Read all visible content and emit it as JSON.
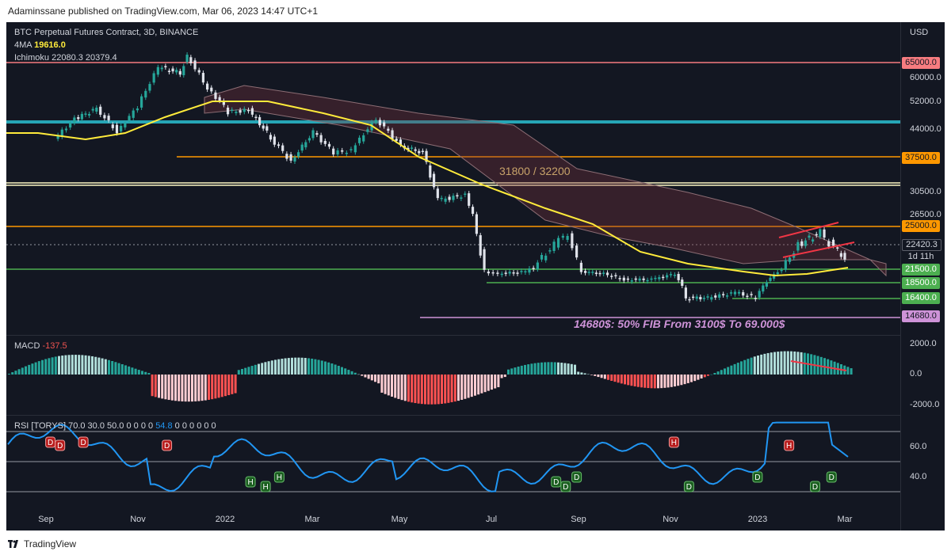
{
  "header": {
    "published": "Adaminssane published on TradingView.com, Mar 06, 2023 14:47 UTC+1"
  },
  "footer": {
    "brand": "TradingView",
    "logo_icon": "tradingview-logo-icon"
  },
  "legend": {
    "symbol": "BTC Perpetual Futures Contract, 3D, BINANCE",
    "ma_label": "4MA",
    "ma_value": "19616.0",
    "ichimoku_label": "Ichimoku",
    "ichimoku_values": "22080.3  20379.4",
    "macd_label": "MACD",
    "macd_value": "-137.5",
    "rsi_label": "RSI [TORYS]",
    "rsi_params": "70.0  30.0  50.0  0  0  0  0",
    "rsi_value": "54.8",
    "rsi_zeros": "0  0  0  0  0  0"
  },
  "chart_data": {
    "type": "candlestick",
    "currency": "USD",
    "x_ticks": [
      "Sep",
      "Nov",
      "2022",
      "Mar",
      "May",
      "Jul",
      "Sep",
      "Nov",
      "2023",
      "Mar"
    ],
    "price_axis_ticks": [
      "60000.0",
      "52000.0",
      "44000.0",
      "30500.0",
      "26500.0"
    ],
    "price_levels": [
      {
        "label": "65000.0",
        "value": 65000,
        "color": "#f77c80"
      },
      {
        "label": "37500.0",
        "value": 37500,
        "color": "#ff9800"
      },
      {
        "label": "25000.0",
        "value": 25000,
        "color": "#ff9800"
      },
      {
        "label": "21500.0",
        "value": 21500,
        "color": "#4caf50"
      },
      {
        "label": "18500.0",
        "value": 18500,
        "color": "#4caf50"
      },
      {
        "label": "16400.0",
        "value": 16400,
        "color": "#4caf50"
      },
      {
        "label": "14680.0",
        "value": 14680,
        "color": "#ce93d8"
      }
    ],
    "current_price": {
      "label": "22420.3",
      "countdown": "1d 11h"
    },
    "annotations": [
      "31800 / 32200",
      "14680$: 50% FIB From 3100$ To 69.000$"
    ],
    "price_series": [
      {
        "d": "2021-08-05",
        "c": 41500
      },
      {
        "d": "2021-08-20",
        "c": 47000
      },
      {
        "d": "2021-09-05",
        "c": 50000
      },
      {
        "d": "2021-09-20",
        "c": 43500
      },
      {
        "d": "2021-10-05",
        "c": 50500
      },
      {
        "d": "2021-10-20",
        "c": 63500
      },
      {
        "d": "2021-11-05",
        "c": 61500
      },
      {
        "d": "2021-11-10",
        "c": 67500
      },
      {
        "d": "2021-11-25",
        "c": 56500
      },
      {
        "d": "2021-12-10",
        "c": 49000
      },
      {
        "d": "2021-12-25",
        "c": 49500
      },
      {
        "d": "2022-01-10",
        "c": 42000
      },
      {
        "d": "2022-01-25",
        "c": 36500
      },
      {
        "d": "2022-02-10",
        "c": 43500
      },
      {
        "d": "2022-02-25",
        "c": 38500
      },
      {
        "d": "2022-03-10",
        "c": 39000
      },
      {
        "d": "2022-03-28",
        "c": 47000
      },
      {
        "d": "2022-04-15",
        "c": 40000
      },
      {
        "d": "2022-05-01",
        "c": 38500
      },
      {
        "d": "2022-05-12",
        "c": 29000
      },
      {
        "d": "2022-06-01",
        "c": 30000
      },
      {
        "d": "2022-06-15",
        "c": 21000
      },
      {
        "d": "2022-06-25",
        "c": 20500
      },
      {
        "d": "2022-07-15",
        "c": 21000
      },
      {
        "d": "2022-08-05",
        "c": 23500
      },
      {
        "d": "2022-08-15",
        "c": 24500
      },
      {
        "d": "2022-08-25",
        "c": 21000
      },
      {
        "d": "2022-09-10",
        "c": 20500
      },
      {
        "d": "2022-09-25",
        "c": 19200
      },
      {
        "d": "2022-10-15",
        "c": 19200
      },
      {
        "d": "2022-11-01",
        "c": 20500
      },
      {
        "d": "2022-11-09",
        "c": 16500
      },
      {
        "d": "2022-11-25",
        "c": 16500
      },
      {
        "d": "2022-12-15",
        "c": 17200
      },
      {
        "d": "2022-12-30",
        "c": 16550
      },
      {
        "d": "2023-01-15",
        "c": 21000
      },
      {
        "d": "2023-01-30",
        "c": 23500
      },
      {
        "d": "2023-02-15",
        "c": 24500
      },
      {
        "d": "2023-02-25",
        "c": 23200
      },
      {
        "d": "2023-03-05",
        "c": 22420
      }
    ],
    "macd_axis_ticks": [
      "2000.0",
      "0.0",
      "-2000.0"
    ],
    "rsi_axis_ticks": [
      "60.0",
      "40.0"
    ],
    "rsi_levels": [
      70,
      50,
      30
    ],
    "rsi_signals": [
      {
        "label": "D",
        "d": "2021-08-01",
        "kind": "bear"
      },
      {
        "label": "D",
        "d": "2021-08-08",
        "kind": "bear"
      },
      {
        "label": "D",
        "d": "2021-08-25",
        "kind": "bear"
      },
      {
        "label": "D",
        "d": "2021-10-25",
        "kind": "bear"
      },
      {
        "label": "H",
        "d": "2021-12-25",
        "kind": "bull"
      },
      {
        "label": "H",
        "d": "2022-01-05",
        "kind": "bull"
      },
      {
        "label": "H",
        "d": "2022-01-15",
        "kind": "bull"
      },
      {
        "label": "D",
        "d": "2022-08-05",
        "kind": "bull"
      },
      {
        "label": "D",
        "d": "2022-08-12",
        "kind": "bull"
      },
      {
        "label": "D",
        "d": "2022-08-20",
        "kind": "bull"
      },
      {
        "label": "H",
        "d": "2022-10-30",
        "kind": "bear"
      },
      {
        "label": "D",
        "d": "2022-11-10",
        "kind": "bull"
      },
      {
        "label": "D",
        "d": "2022-12-30",
        "kind": "bull"
      },
      {
        "label": "H",
        "d": "2023-01-22",
        "kind": "bear"
      },
      {
        "label": "D",
        "d": "2023-02-10",
        "kind": "bull"
      },
      {
        "label": "D",
        "d": "2023-02-22",
        "kind": "bull"
      }
    ]
  }
}
